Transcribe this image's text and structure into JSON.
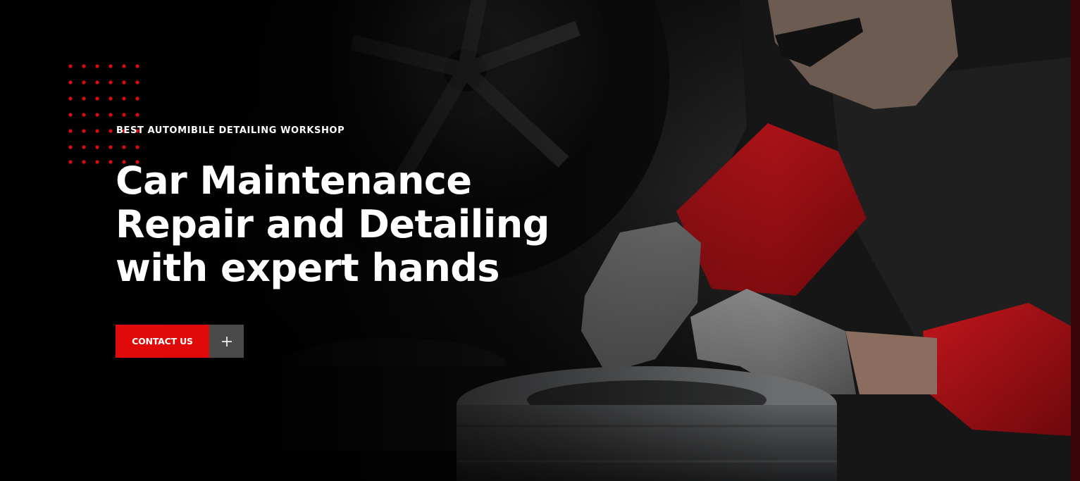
{
  "hero": {
    "eyebrow": "BEST AUTOMIBILE DETAILING WORKSHOP",
    "headline_lines": [
      "Car Maintenance",
      "Repair and Detailing",
      "with expert hands"
    ],
    "cta": {
      "label": "CONTACT US",
      "icon": "plus-icon"
    }
  },
  "colors": {
    "accent": "#e00a0a",
    "cta_icon_bg": "#4a4a4a",
    "text": "#ffffff",
    "background": "#000000"
  }
}
